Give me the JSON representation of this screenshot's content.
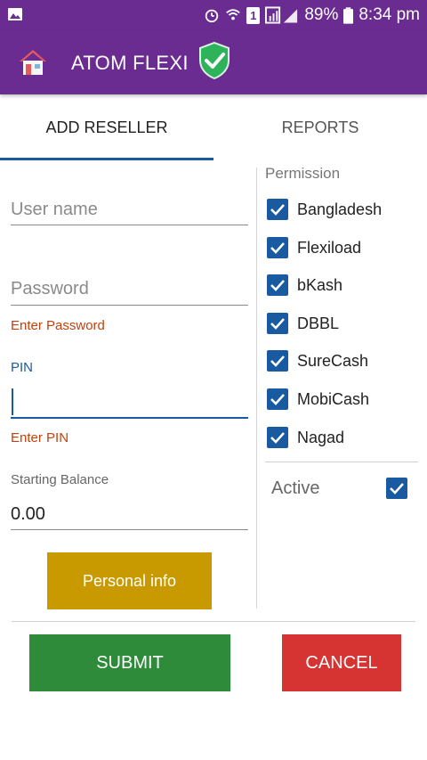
{
  "status_bar": {
    "battery": "89%",
    "time": "8:34 pm",
    "sim": "1",
    "icons": [
      "image-icon",
      "alarm-icon",
      "wifi-icon",
      "sim-icon",
      "signal-icon",
      "battery-icon"
    ]
  },
  "app_bar": {
    "title": "ATOM FLEXI",
    "home_icon": "home-icon",
    "badge_icon": "shield-check-icon",
    "color": "#6a2c91"
  },
  "tabs": [
    {
      "label": "ADD RESELLER",
      "selected": true
    },
    {
      "label": "REPORTS",
      "selected": false
    }
  ],
  "form": {
    "username": {
      "placeholder": "User name",
      "value": ""
    },
    "password": {
      "placeholder": "Password",
      "value": "",
      "error": "Enter Password"
    },
    "pin": {
      "label": "PIN",
      "value": "",
      "error": "Enter PIN"
    },
    "balance": {
      "label": "Starting Balance",
      "value": "0.00"
    },
    "personal_info_label": "Personal info"
  },
  "permissions": {
    "title": "Permission",
    "items": [
      {
        "label": "Bangladesh",
        "checked": true
      },
      {
        "label": "Flexiload",
        "checked": true
      },
      {
        "label": "bKash",
        "checked": true
      },
      {
        "label": "DBBL",
        "checked": true
      },
      {
        "label": "SureCash",
        "checked": true
      },
      {
        "label": "MobiCash",
        "checked": true
      },
      {
        "label": "Nagad",
        "checked": true
      }
    ],
    "active_label": "Active",
    "active_checked": true
  },
  "actions": {
    "submit_label": "SUBMIT",
    "cancel_label": "CANCEL"
  },
  "colors": {
    "accent": "#1a5aa0",
    "error": "#c2410c",
    "personal_btn": "#c99a00",
    "submit_btn": "#2e8b3a",
    "cancel_btn": "#d63333"
  }
}
